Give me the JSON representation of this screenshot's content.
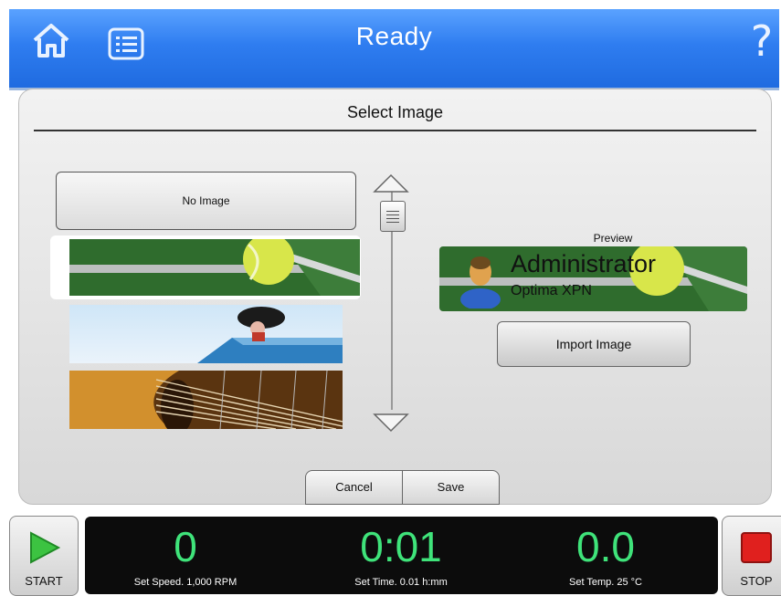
{
  "header": {
    "title": "Ready",
    "help_label": "?"
  },
  "panel": {
    "title": "Select Image",
    "no_image_label": "No Image",
    "thumbnails": [
      "tennis-ball",
      "parachute-sky",
      "guitar-strings"
    ],
    "preview": {
      "label": "Preview",
      "user_name": "Administrator",
      "instrument": "Optima XPN"
    },
    "import_label": "Import Image",
    "cancel_label": "Cancel",
    "save_label": "Save"
  },
  "footer": {
    "start_label": "START",
    "stop_label": "STOP",
    "speed": {
      "value": "0",
      "label": "Set Speed. 1,000 RPM"
    },
    "time": {
      "value": "0:01",
      "label": "Set Time. 0.01 h:mm"
    },
    "temp": {
      "value": "0.0",
      "label": "Set Temp. 25 °C"
    }
  },
  "colors": {
    "header_blue": "#2f7df0",
    "readout_green": "#3fe37a",
    "stop_red": "#e0201e",
    "start_green": "#3cc341"
  },
  "icons": [
    "home-icon",
    "list-icon",
    "help-icon",
    "scroll-up-icon",
    "scroll-down-icon",
    "user-avatar-icon",
    "play-icon",
    "stop-icon"
  ]
}
